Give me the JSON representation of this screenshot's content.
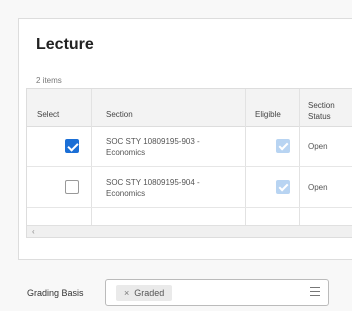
{
  "lecture": {
    "title": "Lecture",
    "item_count": "2 items",
    "columns": [
      "Select",
      "Section",
      "Eligible",
      "Section Status"
    ],
    "rows": [
      {
        "selected": true,
        "section": "SOC STY 10809195-903 - Economics",
        "eligible": true,
        "status": "Open"
      },
      {
        "selected": false,
        "section": "SOC STY 10809195-904 - Economics",
        "eligible": true,
        "status": "Open"
      }
    ],
    "scroll_left_glyph": "‹"
  },
  "grading_basis": {
    "label": "Grading Basis",
    "selected": "Graded",
    "remove_glyph": "×"
  },
  "colors": {
    "accent": "#1b6fd6",
    "eligible": "#b8d4f2"
  }
}
